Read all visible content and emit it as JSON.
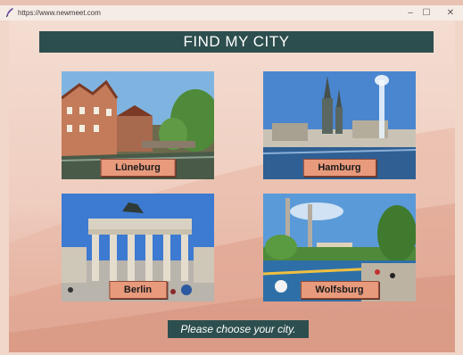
{
  "window": {
    "url": "https://www.newmeet.com",
    "minimize_glyph": "–",
    "maximize_glyph": "☐",
    "close_glyph": "✕"
  },
  "banner": {
    "title": "FIND MY CITY"
  },
  "cities": [
    {
      "label": "Lüneburg"
    },
    {
      "label": "Hamburg"
    },
    {
      "label": "Berlin"
    },
    {
      "label": "Wolfsburg"
    }
  ],
  "prompt": {
    "text": "Please choose your city."
  },
  "colors": {
    "banner_bg": "#2d4e4e",
    "button_bg": "#e89a7c",
    "background": "#f1d6ca"
  }
}
